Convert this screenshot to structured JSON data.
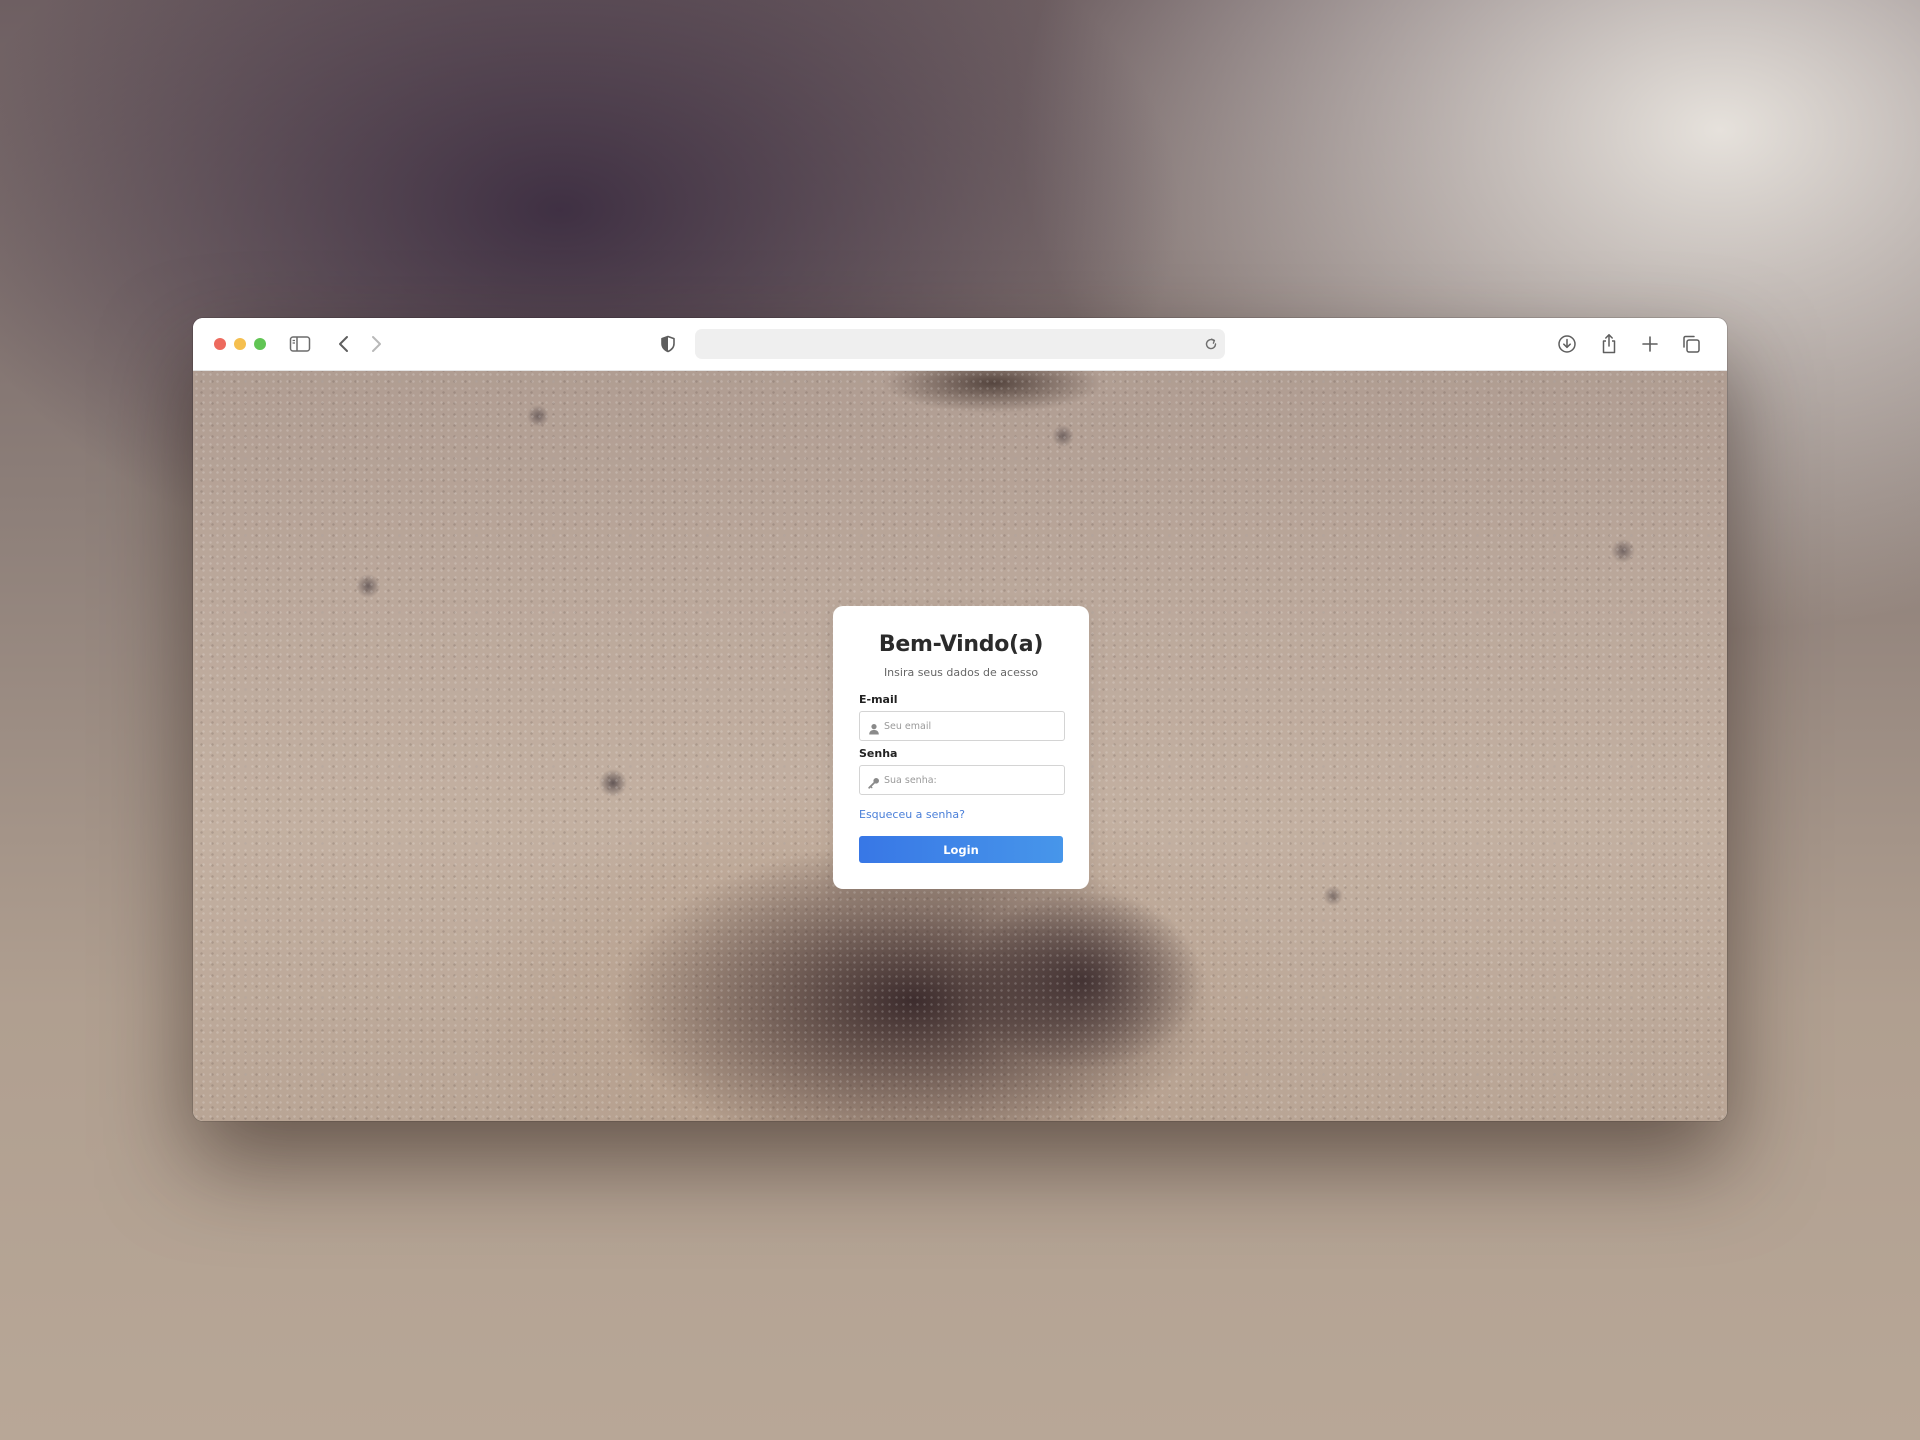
{
  "browser": {
    "address_value": "",
    "icons": {
      "sidebar": "sidebar-toggle-icon",
      "back": "chevron-left-icon",
      "forward": "chevron-right-icon",
      "privacy": "shield-icon",
      "reload": "reload-icon",
      "download": "download-icon",
      "share": "share-icon",
      "new_tab": "plus-icon",
      "tabs": "tab-overview-icon"
    },
    "traffic_light_colors": [
      "#ed6a5e",
      "#f5bf4f",
      "#61c554"
    ]
  },
  "login": {
    "title": "Bem-Vindo(a)",
    "subtitle": "Insira seus dados de acesso",
    "email_label": "E-mail",
    "email_placeholder": "Seu email",
    "password_label": "Senha",
    "password_placeholder": "Sua senha:",
    "forgot_link": "Esqueceu a senha?",
    "submit_label": "Login",
    "accent_color": "#3a7de6",
    "link_color": "#4a7fd8"
  }
}
